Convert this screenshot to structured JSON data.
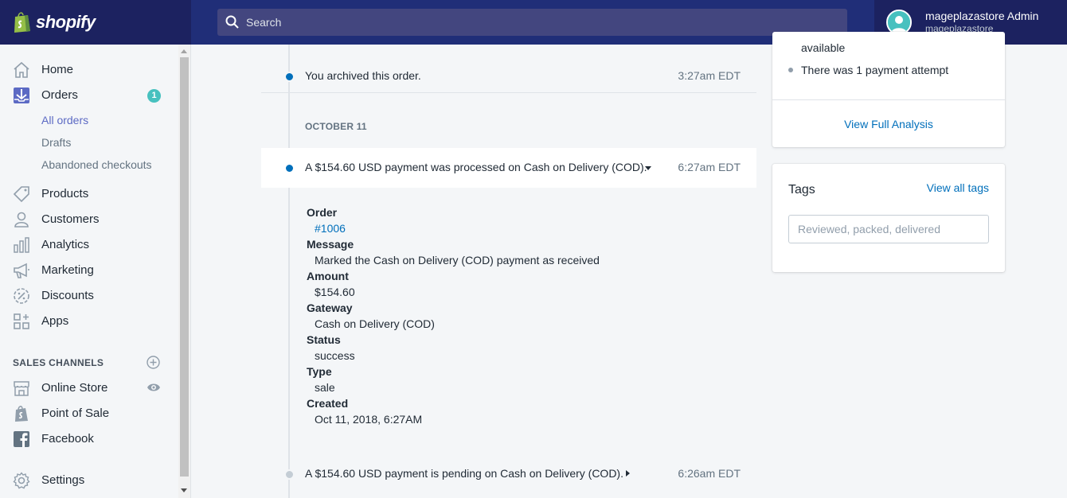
{
  "brand": {
    "logo_text": "shopify",
    "brand_color": "#95bf47"
  },
  "search": {
    "placeholder": "Search"
  },
  "user": {
    "name": "mageplazastore Admin",
    "store": "mageplazastore"
  },
  "sidebar": {
    "items": [
      {
        "label": "Home",
        "icon": "home-icon"
      },
      {
        "label": "Orders",
        "icon": "orders-icon",
        "badge": "1"
      },
      {
        "label": "Products",
        "icon": "tag-icon"
      },
      {
        "label": "Customers",
        "icon": "person-icon"
      },
      {
        "label": "Analytics",
        "icon": "bar-chart-icon"
      },
      {
        "label": "Marketing",
        "icon": "megaphone-icon"
      },
      {
        "label": "Discounts",
        "icon": "discount-icon"
      },
      {
        "label": "Apps",
        "icon": "apps-icon"
      }
    ],
    "order_sub": [
      "All orders",
      "Drafts",
      "Abandoned checkouts"
    ],
    "channels_heading": "SALES CHANNELS",
    "channels": [
      {
        "label": "Online Store",
        "icon": "store-icon"
      },
      {
        "label": "Point of Sale",
        "icon": "pos-icon"
      },
      {
        "label": "Facebook",
        "icon": "facebook-icon"
      }
    ],
    "settings_label": "Settings"
  },
  "timeline": {
    "archived": {
      "text": "You archived this order.",
      "time": "3:27am EDT"
    },
    "date_heading": "OCTOBER 11",
    "processed": {
      "text": "A $154.60 USD payment was processed on Cash on Delivery (COD).",
      "time": "6:27am EDT"
    },
    "details": {
      "order_label": "Order",
      "order_value": "#1006",
      "message_label": "Message",
      "message_value": "Marked the Cash on Delivery (COD) payment as received",
      "amount_label": "Amount",
      "amount_value": "$154.60",
      "gateway_label": "Gateway",
      "gateway_value": "Cash on Delivery (COD)",
      "status_label": "Status",
      "status_value": "success",
      "type_label": "Type",
      "type_value": "sale",
      "created_label": "Created",
      "created_value": "Oct 11, 2018, 6:27AM"
    },
    "pending": {
      "text": "A $154.60 USD payment is pending on Cash on Delivery (COD).",
      "time": "6:26am EDT"
    }
  },
  "risk": {
    "available_text": "available",
    "attempt_text": "There was 1 payment attempt",
    "view_analysis": "View Full Analysis"
  },
  "tags": {
    "title": "Tags",
    "view_all": "View all tags",
    "placeholder": "Reviewed, packed, delivered"
  }
}
